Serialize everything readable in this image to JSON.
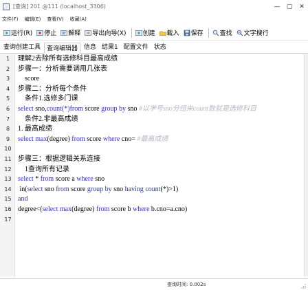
{
  "window": {
    "title": "[查询] 201 @111 (localhost_3306)",
    "controls": {
      "minimize": "—",
      "maximize": "▢",
      "close": "✕"
    }
  },
  "menubar": {
    "items": [
      "文件(F)",
      "编辑(E)",
      "查看(V)",
      "收藏(A)"
    ]
  },
  "toolbar": {
    "run": "运行(R)",
    "stop": "停止",
    "explain": "解释",
    "export_wizard": "导出向导(X)",
    "create": "创建",
    "load": "载入",
    "save": "保存",
    "find": "查找",
    "text_replace": "文字搜行"
  },
  "tabs": [
    {
      "label": "查询创建工具",
      "active": false
    },
    {
      "label": "查询编辑器",
      "active": true
    },
    {
      "label": "信息",
      "active": false
    },
    {
      "label": "结果1",
      "active": false
    },
    {
      "label": "配置文件",
      "active": false
    },
    {
      "label": "状态",
      "active": false
    }
  ],
  "editor": {
    "line_numbers": [
      "1",
      "2",
      "3",
      "4",
      "5",
      "6",
      "7",
      "8",
      "9",
      "10",
      "11",
      "12",
      "13",
      "14",
      "15",
      "16",
      "17"
    ],
    "lines": [
      [
        {
          "t": "理解2去除所有选修科目最高成绩",
          "c": "tx"
        }
      ],
      [
        {
          "t": "步骤一：分析需要调用几张表",
          "c": "tx"
        }
      ],
      [
        {
          "t": "    score",
          "c": "tx"
        }
      ],
      [
        {
          "t": "步骤二：分析每个条件",
          "c": "tx"
        }
      ],
      [
        {
          "t": "    条件1.选修多门课",
          "c": "tx"
        }
      ],
      [
        {
          "t": "select ",
          "c": "kw"
        },
        {
          "t": "sno,",
          "c": "tx"
        },
        {
          "t": "count(*)",
          "c": "kw"
        },
        {
          "t": "from ",
          "c": "kw"
        },
        {
          "t": "score ",
          "c": "tx"
        },
        {
          "t": "group by ",
          "c": "kw"
        },
        {
          "t": "sno",
          "c": "tx"
        },
        {
          "t": " #以学号sno分组来count数就是选修科目",
          "c": "cm"
        }
      ],
      [
        {
          "t": "    条件2.非最高成绩",
          "c": "tx"
        }
      ],
      [
        {
          "t": "1. 最高成绩",
          "c": "tx"
        }
      ],
      [
        {
          "t": "select ",
          "c": "kw"
        },
        {
          "t": "max",
          "c": "kw"
        },
        {
          "t": "(degree) ",
          "c": "tx"
        },
        {
          "t": "from ",
          "c": "kw"
        },
        {
          "t": "score ",
          "c": "tx"
        },
        {
          "t": "where ",
          "c": "kw"
        },
        {
          "t": "cno=",
          "c": "tx"
        },
        {
          "t": " #最高成绩",
          "c": "cm"
        }
      ],
      [
        {
          "t": "",
          "c": "tx"
        }
      ],
      [
        {
          "t": "步骤三：根据逻辑关系连接",
          "c": "tx"
        }
      ],
      [
        {
          "t": "    1查询所有记录",
          "c": "tx"
        }
      ],
      [
        {
          "t": "select ",
          "c": "kw"
        },
        {
          "t": "* ",
          "c": "tx"
        },
        {
          "t": "from ",
          "c": "kw"
        },
        {
          "t": "score a ",
          "c": "tx"
        },
        {
          "t": "where ",
          "c": "kw"
        },
        {
          "t": "sno",
          "c": "tx"
        }
      ],
      [
        {
          "t": " in(",
          "c": "tx"
        },
        {
          "t": "select ",
          "c": "kw"
        },
        {
          "t": "sno ",
          "c": "tx"
        },
        {
          "t": "from ",
          "c": "kw"
        },
        {
          "t": "score ",
          "c": "tx"
        },
        {
          "t": "group by ",
          "c": "kw"
        },
        {
          "t": "sno ",
          "c": "tx"
        },
        {
          "t": "having ",
          "c": "kw"
        },
        {
          "t": "count",
          "c": "kw"
        },
        {
          "t": "(*)>1)",
          "c": "tx"
        }
      ],
      [
        {
          "t": "and",
          "c": "kw"
        }
      ],
      [
        {
          "t": "degree<(",
          "c": "tx"
        },
        {
          "t": "select ",
          "c": "kw"
        },
        {
          "t": "max",
          "c": "kw"
        },
        {
          "t": "(degree) ",
          "c": "tx"
        },
        {
          "t": "from ",
          "c": "kw"
        },
        {
          "t": "score b ",
          "c": "tx"
        },
        {
          "t": "where ",
          "c": "kw"
        },
        {
          "t": "b.cno=a.cno)",
          "c": "tx"
        }
      ],
      [
        {
          "t": "",
          "c": "tx"
        }
      ]
    ]
  },
  "statusbar": {
    "query_time": "查询时间: 0.002s"
  },
  "colors": {
    "keyword": "#2f2fc8",
    "comment": "#b7b7c7",
    "gutter_bg": "#f4f4f4"
  },
  "icons": {
    "run": "run-icon",
    "stop": "stop-icon",
    "explain": "explain-icon",
    "export": "export-icon",
    "create": "create-icon",
    "load": "load-icon",
    "save": "save-icon",
    "find": "find-icon",
    "replace": "replace-icon"
  }
}
